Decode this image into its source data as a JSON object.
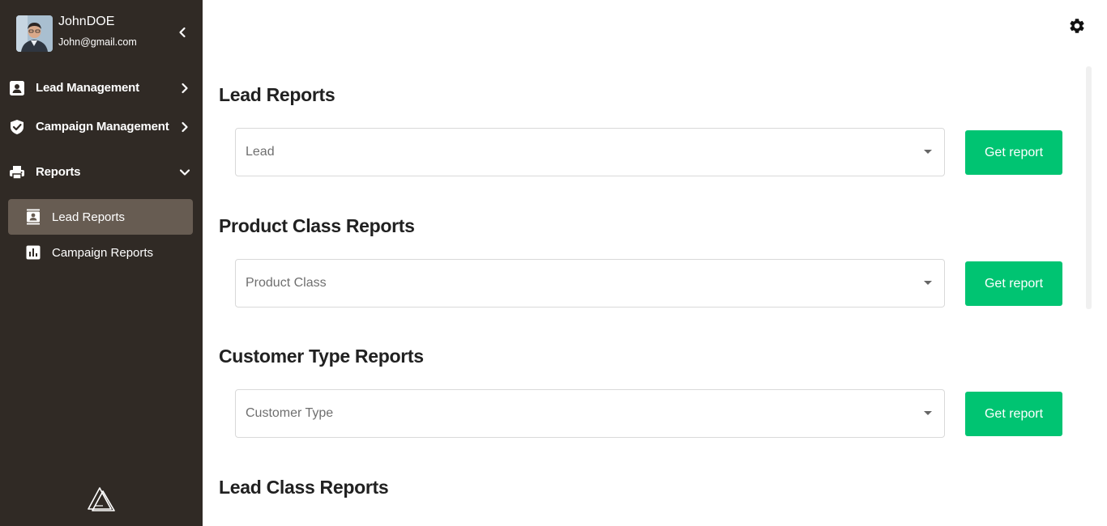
{
  "user": {
    "name": "JohnDOE",
    "email": "John@gmail.com"
  },
  "sidebar": {
    "items": [
      {
        "label": "Lead Management",
        "icon": "contact-card-icon"
      },
      {
        "label": "Campaign Management",
        "icon": "shield-check-icon"
      },
      {
        "label": "Reports",
        "icon": "printer-icon",
        "expanded": true
      }
    ],
    "sub_items": [
      {
        "label": "Lead Reports",
        "icon": "contacts-book-icon",
        "active": true
      },
      {
        "label": "Campaign Reports",
        "icon": "bar-chart-icon",
        "active": false
      }
    ]
  },
  "sections": [
    {
      "title": "Lead Reports",
      "select_placeholder": "Lead",
      "button_label": "Get report"
    },
    {
      "title": "Product Class Reports",
      "select_placeholder": "Product Class",
      "button_label": "Get report"
    },
    {
      "title": "Customer Type Reports",
      "select_placeholder": "Customer Type",
      "button_label": "Get report"
    },
    {
      "title": "Lead Class Reports"
    }
  ],
  "colors": {
    "sidebar_bg": "#302a25",
    "active_item_bg": "#675c52",
    "accent_green": "#00c472"
  }
}
